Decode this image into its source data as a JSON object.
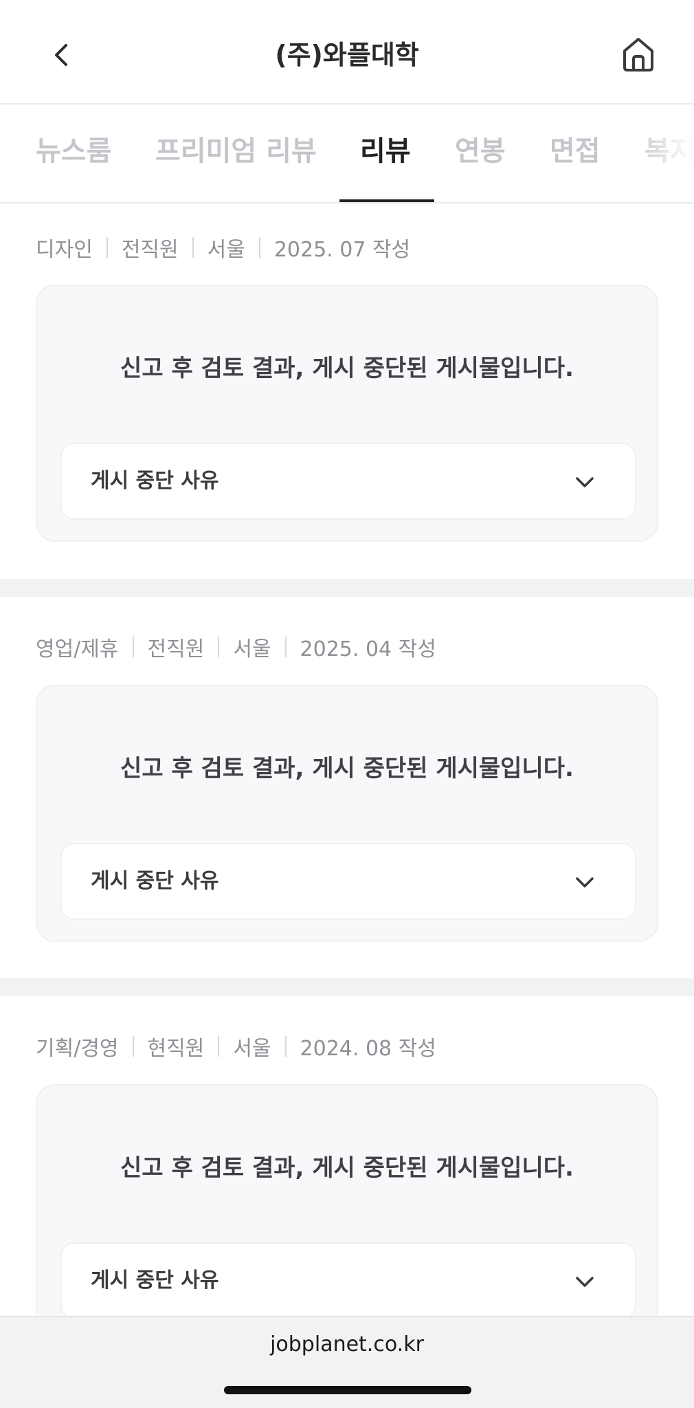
{
  "header": {
    "title": "(주)와플대학",
    "back_icon": "chevron-left-icon",
    "home_icon": "home-icon"
  },
  "tabs": [
    {
      "label": "뉴스룸",
      "active": false
    },
    {
      "label": "프리미엄 리뷰",
      "active": false
    },
    {
      "label": "리뷰",
      "active": true
    },
    {
      "label": "연봉",
      "active": false
    },
    {
      "label": "면접",
      "active": false
    },
    {
      "label": "복지",
      "active": false
    }
  ],
  "reviews": [
    {
      "job": "디자인",
      "status": "전직원",
      "location": "서울",
      "date": "2025. 07 작성",
      "notice": "신고 후 검토 결과, 게시 중단된 게시물입니다.",
      "reason_label": "게시 중단 사유"
    },
    {
      "job": "영업/제휴",
      "status": "전직원",
      "location": "서울",
      "date": "2025. 04 작성",
      "notice": "신고 후 검토 결과, 게시 중단된 게시물입니다.",
      "reason_label": "게시 중단 사유"
    },
    {
      "job": "기획/경영",
      "status": "현직원",
      "location": "서울",
      "date": "2024. 08 작성",
      "notice": "신고 후 검토 결과, 게시 중단된 게시물입니다.",
      "reason_label": "게시 중단 사유"
    }
  ],
  "browser": {
    "url": "jobplanet.co.kr"
  },
  "colors": {
    "active_tab": "#222222",
    "inactive_tab": "#c4c6cb",
    "card_bg": "#f7f8fa",
    "meta_text": "#8e9096"
  }
}
